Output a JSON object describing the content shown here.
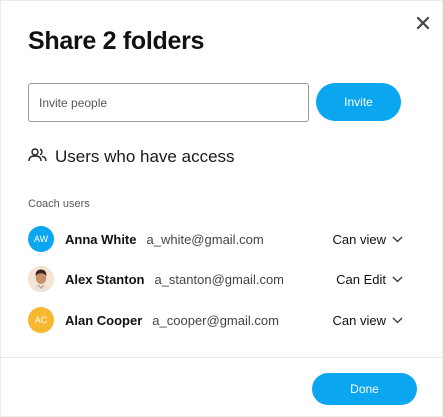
{
  "dialog": {
    "title": "Share 2 folders",
    "invite": {
      "placeholder": "Invite people",
      "value": "",
      "button_label": "Invite"
    },
    "access_section": {
      "title": "Users who have access",
      "icon": "users-icon"
    },
    "group_label": "Coach users",
    "users": [
      {
        "initials": "AW",
        "name": "Anna White",
        "email": "a_white@gmail.com",
        "permission": "Can view",
        "avatar_color": "#0aa6f0",
        "avatar_type": "initials"
      },
      {
        "initials": "",
        "name": "Alex Stanton",
        "email": "a_stanton@gmail.com",
        "permission": "Can Edit",
        "avatar_color": "#f2d2b6",
        "avatar_type": "photo"
      },
      {
        "initials": "AC",
        "name": "Alan Cooper",
        "email": "a_cooper@gmail.com",
        "permission": "Can view",
        "avatar_color": "#f5b82e",
        "avatar_type": "initials"
      }
    ],
    "done_label": "Done"
  },
  "colors": {
    "primary": "#0aa6f0",
    "avatar_blue": "#0aa6f0",
    "avatar_yellow": "#f5b82e"
  }
}
